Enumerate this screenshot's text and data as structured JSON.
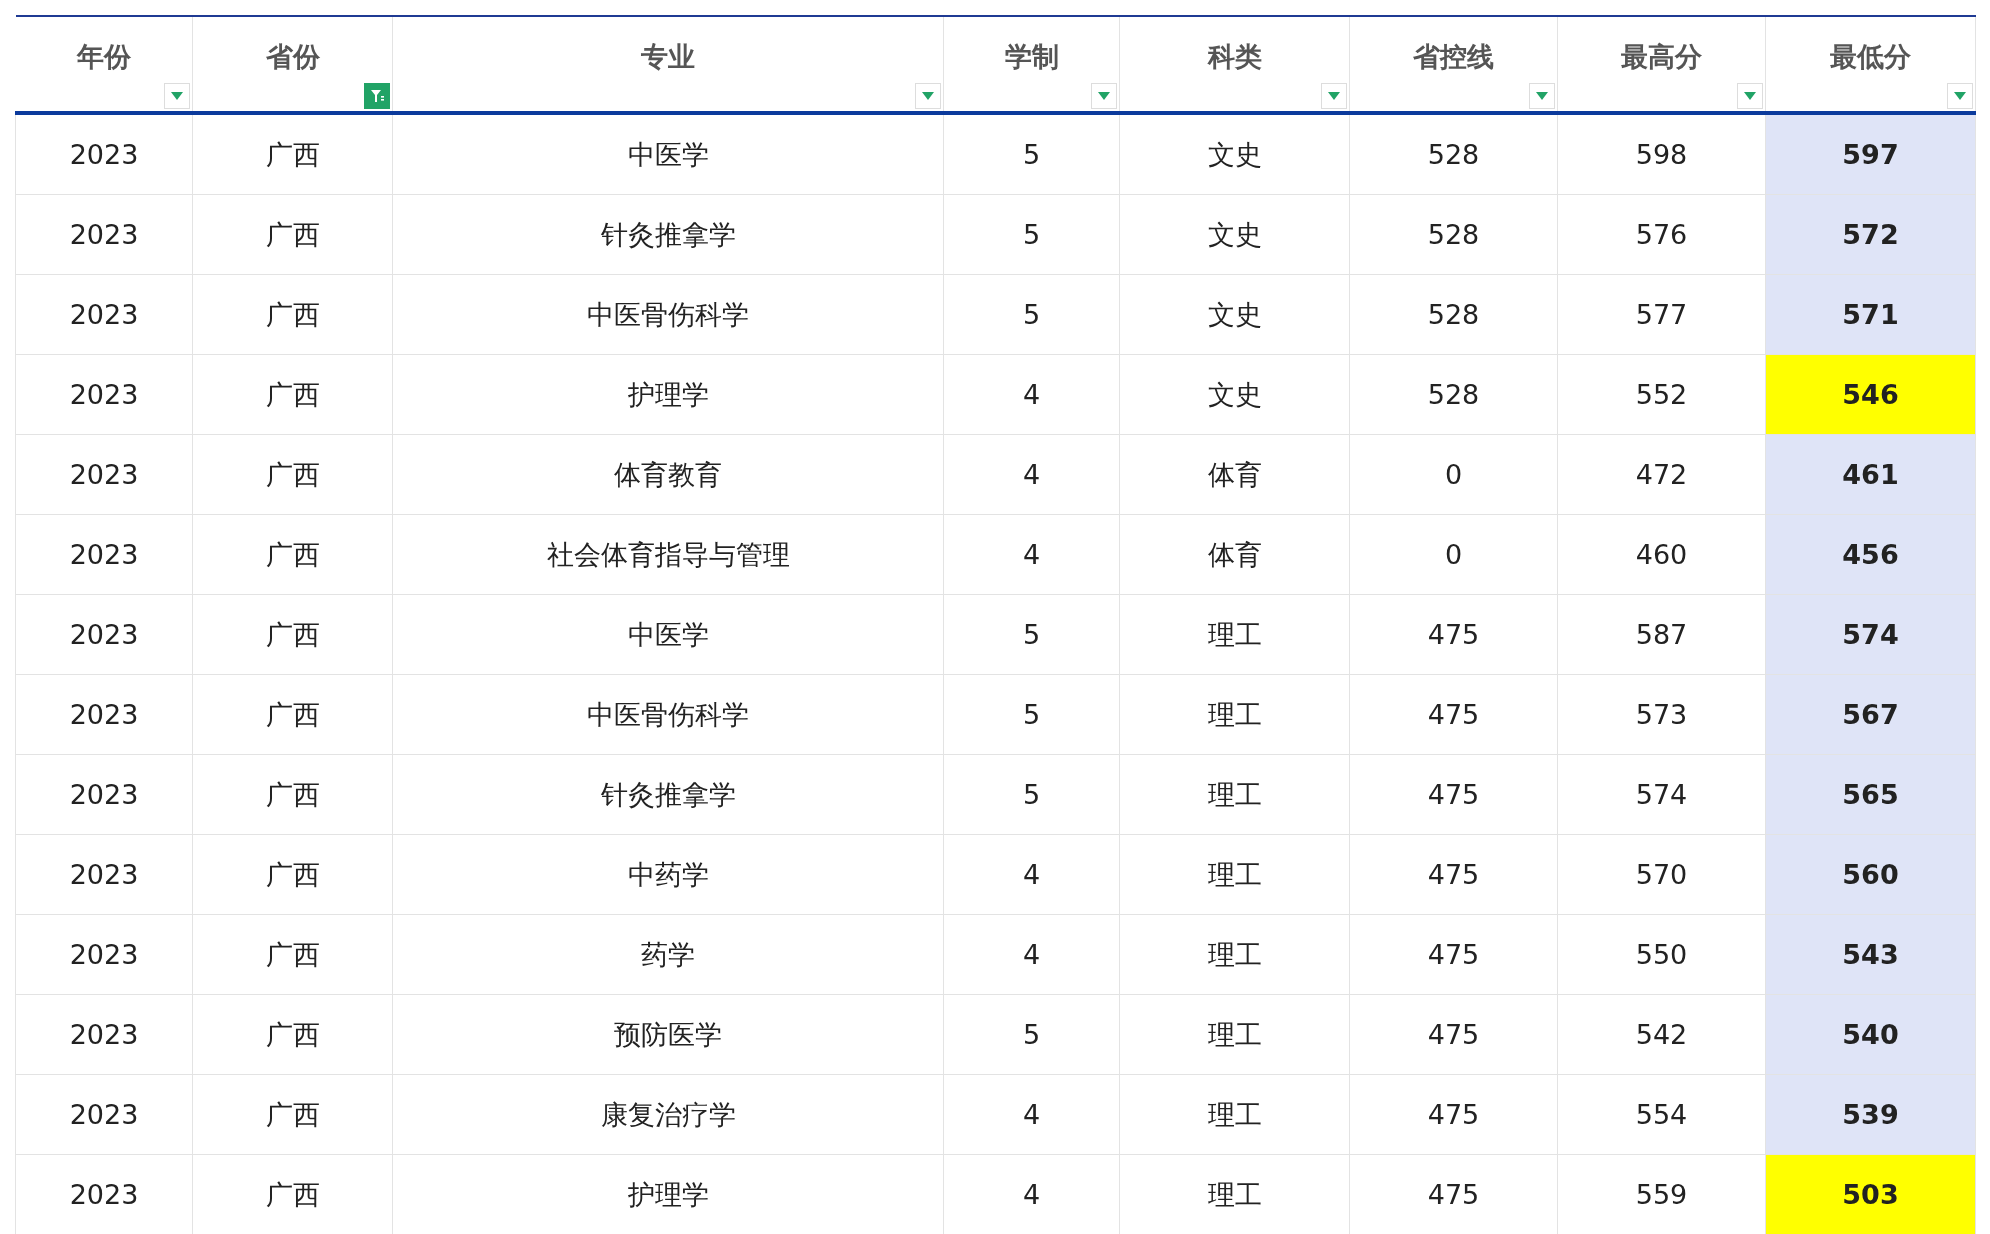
{
  "table": {
    "columns": [
      {
        "label": "年份",
        "filtered": false
      },
      {
        "label": "省份",
        "filtered": true
      },
      {
        "label": "专业",
        "filtered": false
      },
      {
        "label": "学制",
        "filtered": false
      },
      {
        "label": "科类",
        "filtered": false
      },
      {
        "label": "省控线",
        "filtered": false
      },
      {
        "label": "最高分",
        "filtered": false
      },
      {
        "label": "最低分",
        "filtered": false
      }
    ],
    "rows": [
      {
        "cells": [
          "2023",
          "广西",
          "中医学",
          "5",
          "文史",
          "528",
          "598",
          "597"
        ],
        "highlighted": false
      },
      {
        "cells": [
          "2023",
          "广西",
          "针灸推拿学",
          "5",
          "文史",
          "528",
          "576",
          "572"
        ],
        "highlighted": false
      },
      {
        "cells": [
          "2023",
          "广西",
          "中医骨伤科学",
          "5",
          "文史",
          "528",
          "577",
          "571"
        ],
        "highlighted": false
      },
      {
        "cells": [
          "2023",
          "广西",
          "护理学",
          "4",
          "文史",
          "528",
          "552",
          "546"
        ],
        "highlighted": true
      },
      {
        "cells": [
          "2023",
          "广西",
          "体育教育",
          "4",
          "体育",
          "0",
          "472",
          "461"
        ],
        "highlighted": false
      },
      {
        "cells": [
          "2023",
          "广西",
          "社会体育指导与管理",
          "4",
          "体育",
          "0",
          "460",
          "456"
        ],
        "highlighted": false
      },
      {
        "cells": [
          "2023",
          "广西",
          "中医学",
          "5",
          "理工",
          "475",
          "587",
          "574"
        ],
        "highlighted": false
      },
      {
        "cells": [
          "2023",
          "广西",
          "中医骨伤科学",
          "5",
          "理工",
          "475",
          "573",
          "567"
        ],
        "highlighted": false
      },
      {
        "cells": [
          "2023",
          "广西",
          "针灸推拿学",
          "5",
          "理工",
          "475",
          "574",
          "565"
        ],
        "highlighted": false
      },
      {
        "cells": [
          "2023",
          "广西",
          "中药学",
          "4",
          "理工",
          "475",
          "570",
          "560"
        ],
        "highlighted": false
      },
      {
        "cells": [
          "2023",
          "广西",
          "药学",
          "4",
          "理工",
          "475",
          "550",
          "543"
        ],
        "highlighted": false
      },
      {
        "cells": [
          "2023",
          "广西",
          "预防医学",
          "5",
          "理工",
          "475",
          "542",
          "540"
        ],
        "highlighted": false
      },
      {
        "cells": [
          "2023",
          "广西",
          "康复治疗学",
          "4",
          "理工",
          "475",
          "554",
          "539"
        ],
        "highlighted": false
      },
      {
        "cells": [
          "2023",
          "广西",
          "护理学",
          "4",
          "理工",
          "475",
          "559",
          "503"
        ],
        "highlighted": true
      }
    ]
  }
}
